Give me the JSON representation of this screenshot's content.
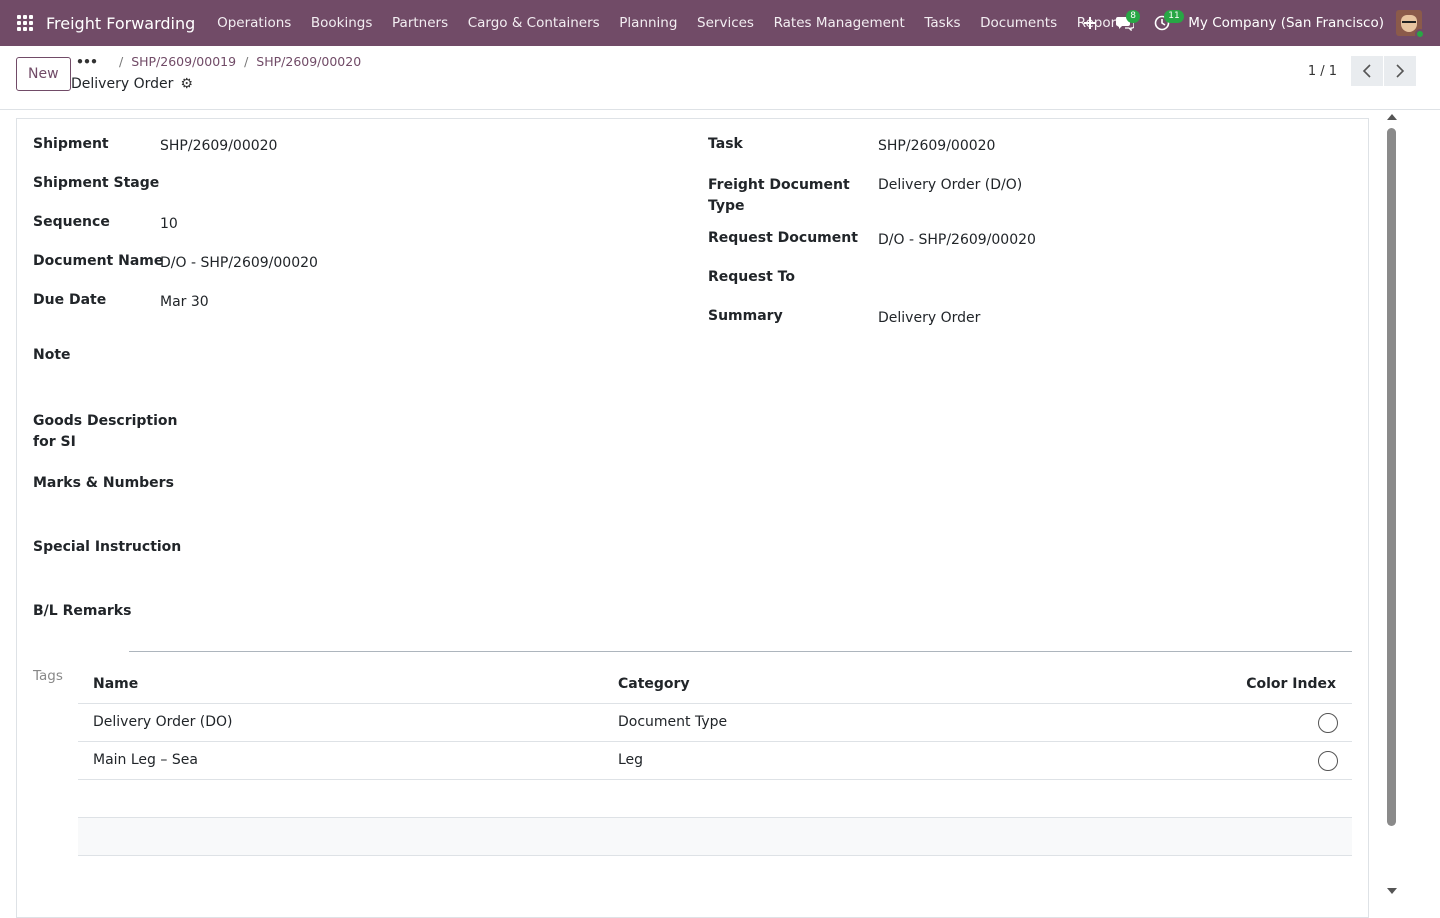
{
  "navbar": {
    "app_name": "Freight Forwarding",
    "menu": [
      "Operations",
      "Bookings",
      "Partners",
      "Cargo & Containers",
      "Planning",
      "Services",
      "Rates Management",
      "Tasks",
      "Documents",
      "Report"
    ],
    "messages_count": "8",
    "activities_count": "11",
    "company": "My Company (San Francisco)",
    "bg_color": "#714b67"
  },
  "control": {
    "new_label": "New",
    "breadcrumb_dots": "•••",
    "breadcrumbs": [
      "SHP/2609/00019",
      "SHP/2609/00020"
    ],
    "record_title": "Delivery Order",
    "pager_value": "1 / 1"
  },
  "form": {
    "left": [
      {
        "label": "Shipment",
        "value": "SHP/2609/00020"
      },
      {
        "label": "Shipment Stage",
        "value": ""
      },
      {
        "label": "Sequence",
        "value": "10"
      },
      {
        "label": "Document Name",
        "value": "D/O - SHP/2609/00020"
      },
      {
        "label": "Due Date",
        "value": "Mar 30"
      },
      {
        "label": "Note",
        "value": ""
      },
      {
        "label": "Goods Description for SI",
        "value": ""
      },
      {
        "label": "Marks & Numbers",
        "value": ""
      },
      {
        "label": "Special Instruction",
        "value": ""
      },
      {
        "label": "B/L Remarks",
        "value": ""
      }
    ],
    "right": [
      {
        "label": "Task",
        "value": "SHP/2609/00020"
      },
      {
        "label": "Freight Document Type",
        "value": "Delivery Order (D/O)"
      },
      {
        "label": "Request Document",
        "value": "D/O - SHP/2609/00020"
      },
      {
        "label": "Request To",
        "value": ""
      },
      {
        "label": "Summary",
        "value": "Delivery Order"
      }
    ]
  },
  "tags": {
    "label": "Tags",
    "columns": [
      "Name",
      "Category",
      "Color Index"
    ],
    "rows": [
      {
        "name": "Delivery Order (DO)",
        "category": "Document Type"
      },
      {
        "name": "Main Leg – Sea",
        "category": "Leg"
      }
    ]
  }
}
